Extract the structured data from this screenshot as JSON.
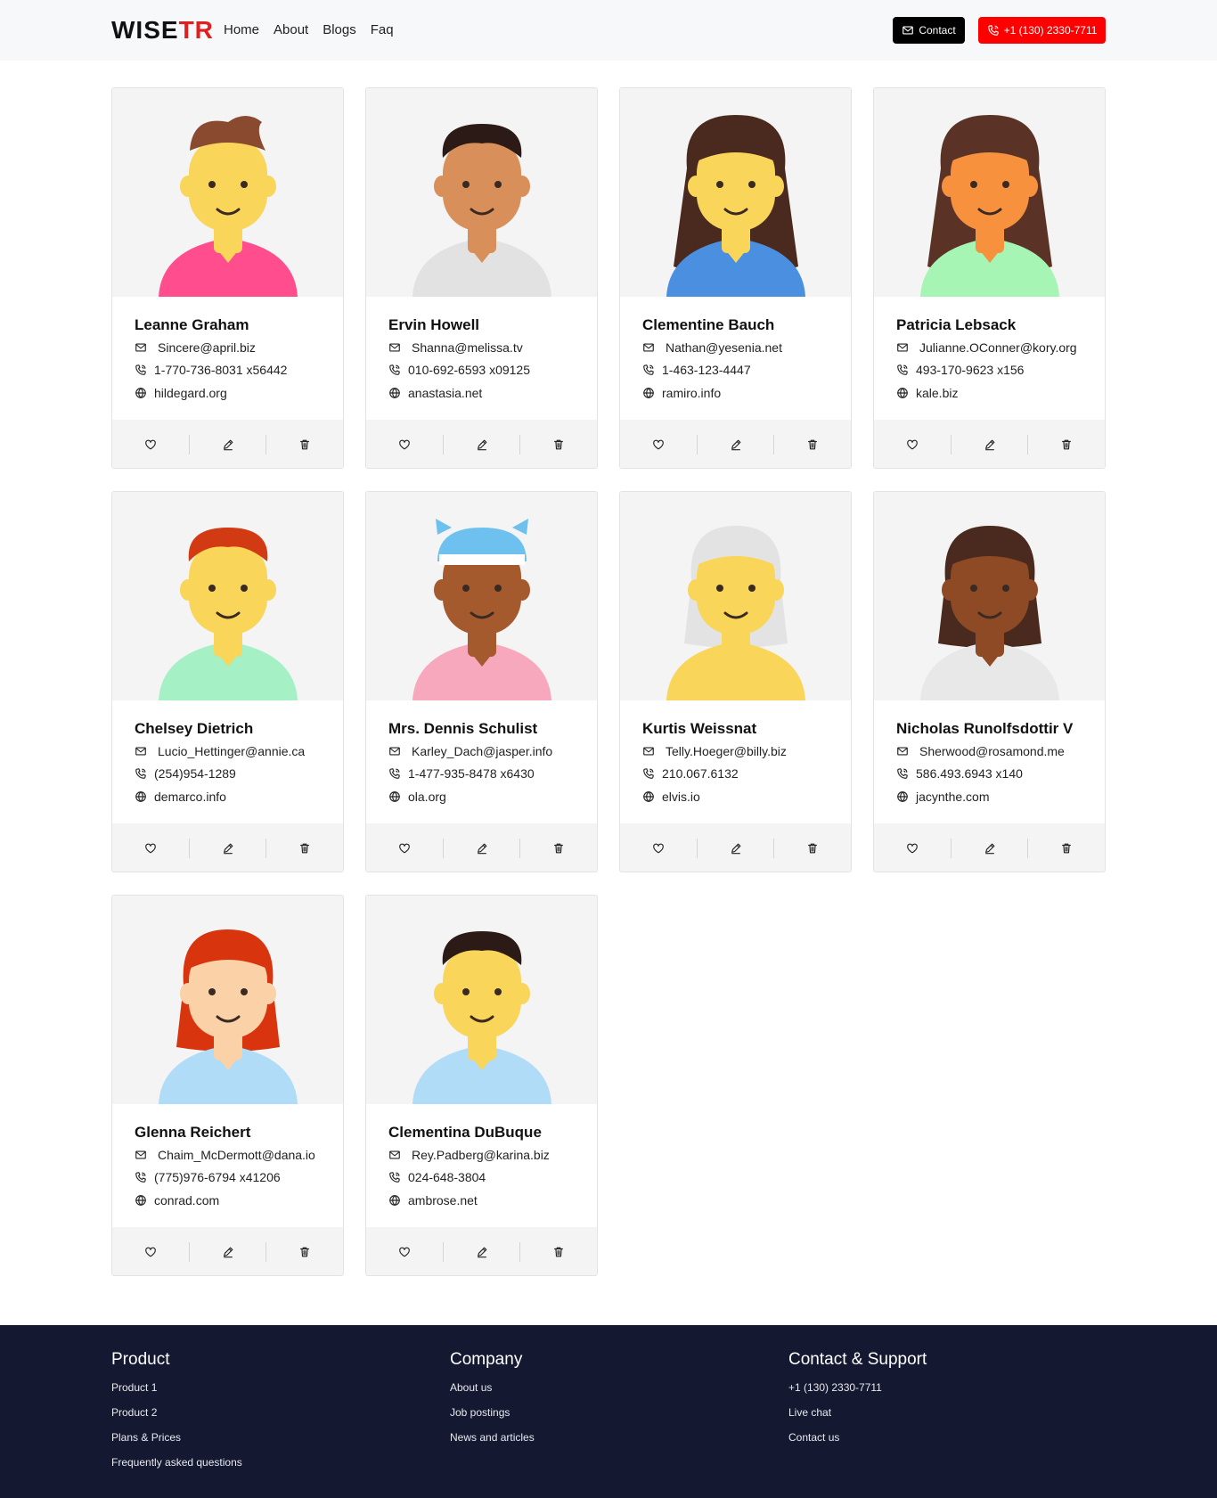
{
  "header": {
    "logo_main": "WISE",
    "logo_accent": "TR",
    "nav": [
      "Home",
      "About",
      "Blogs",
      "Faq"
    ],
    "contact_label": "Contact",
    "phone_label": "+1 (130) 2330-7711"
  },
  "users": [
    {
      "name": "Leanne Graham",
      "email": "Sincere@april.biz",
      "phone": "1-770-736-8031 x56442",
      "website": "hildegard.org"
    },
    {
      "name": "Ervin Howell",
      "email": "Shanna@melissa.tv",
      "phone": "010-692-6593 x09125",
      "website": "anastasia.net"
    },
    {
      "name": "Clementine Bauch",
      "email": "Nathan@yesenia.net",
      "phone": "1-463-123-4447",
      "website": "ramiro.info"
    },
    {
      "name": "Patricia Lebsack",
      "email": "Julianne.OConner@kory.org",
      "phone": "493-170-9623 x156",
      "website": "kale.biz"
    },
    {
      "name": "Chelsey Dietrich",
      "email": "Lucio_Hettinger@annie.ca",
      "phone": "(254)954-1289",
      "website": "demarco.info"
    },
    {
      "name": "Mrs. Dennis Schulist",
      "email": "Karley_Dach@jasper.info",
      "phone": "1-477-935-8478 x6430",
      "website": "ola.org"
    },
    {
      "name": "Kurtis Weissnat",
      "email": "Telly.Hoeger@billy.biz",
      "phone": "210.067.6132",
      "website": "elvis.io"
    },
    {
      "name": "Nicholas Runolfsdottir V",
      "email": "Sherwood@rosamond.me",
      "phone": "586.493.6943 x140",
      "website": "jacynthe.com"
    },
    {
      "name": "Glenna Reichert",
      "email": "Chaim_McDermott@dana.io",
      "phone": "(775)976-6794 x41206",
      "website": "conrad.com"
    },
    {
      "name": "Clementina DuBuque",
      "email": "Rey.Padberg@karina.biz",
      "phone": "024-648-3804",
      "website": "ambrose.net"
    }
  ],
  "icons": {
    "email": "mail-icon",
    "phone": "phone-icon",
    "website": "globe-icon",
    "like": "heart-icon",
    "edit": "pencil-icon",
    "delete": "trash-icon"
  },
  "footer": {
    "columns": [
      {
        "title": "Product",
        "links": [
          "Product 1",
          "Product 2",
          "Plans & Prices",
          "Frequently asked questions"
        ]
      },
      {
        "title": "Company",
        "links": [
          "About us",
          "Job postings",
          "News and articles"
        ]
      },
      {
        "title": "Contact & Support",
        "links": [
          "+1 (130) 2330-7711",
          "Live chat",
          "Contact us"
        ]
      }
    ]
  },
  "colors": {
    "accent_red": "#e0201e",
    "phone_button": "#ff0000",
    "contact_button": "#000000",
    "footer_bg": "#141830",
    "avatar_bg": "#f3f4f3"
  }
}
